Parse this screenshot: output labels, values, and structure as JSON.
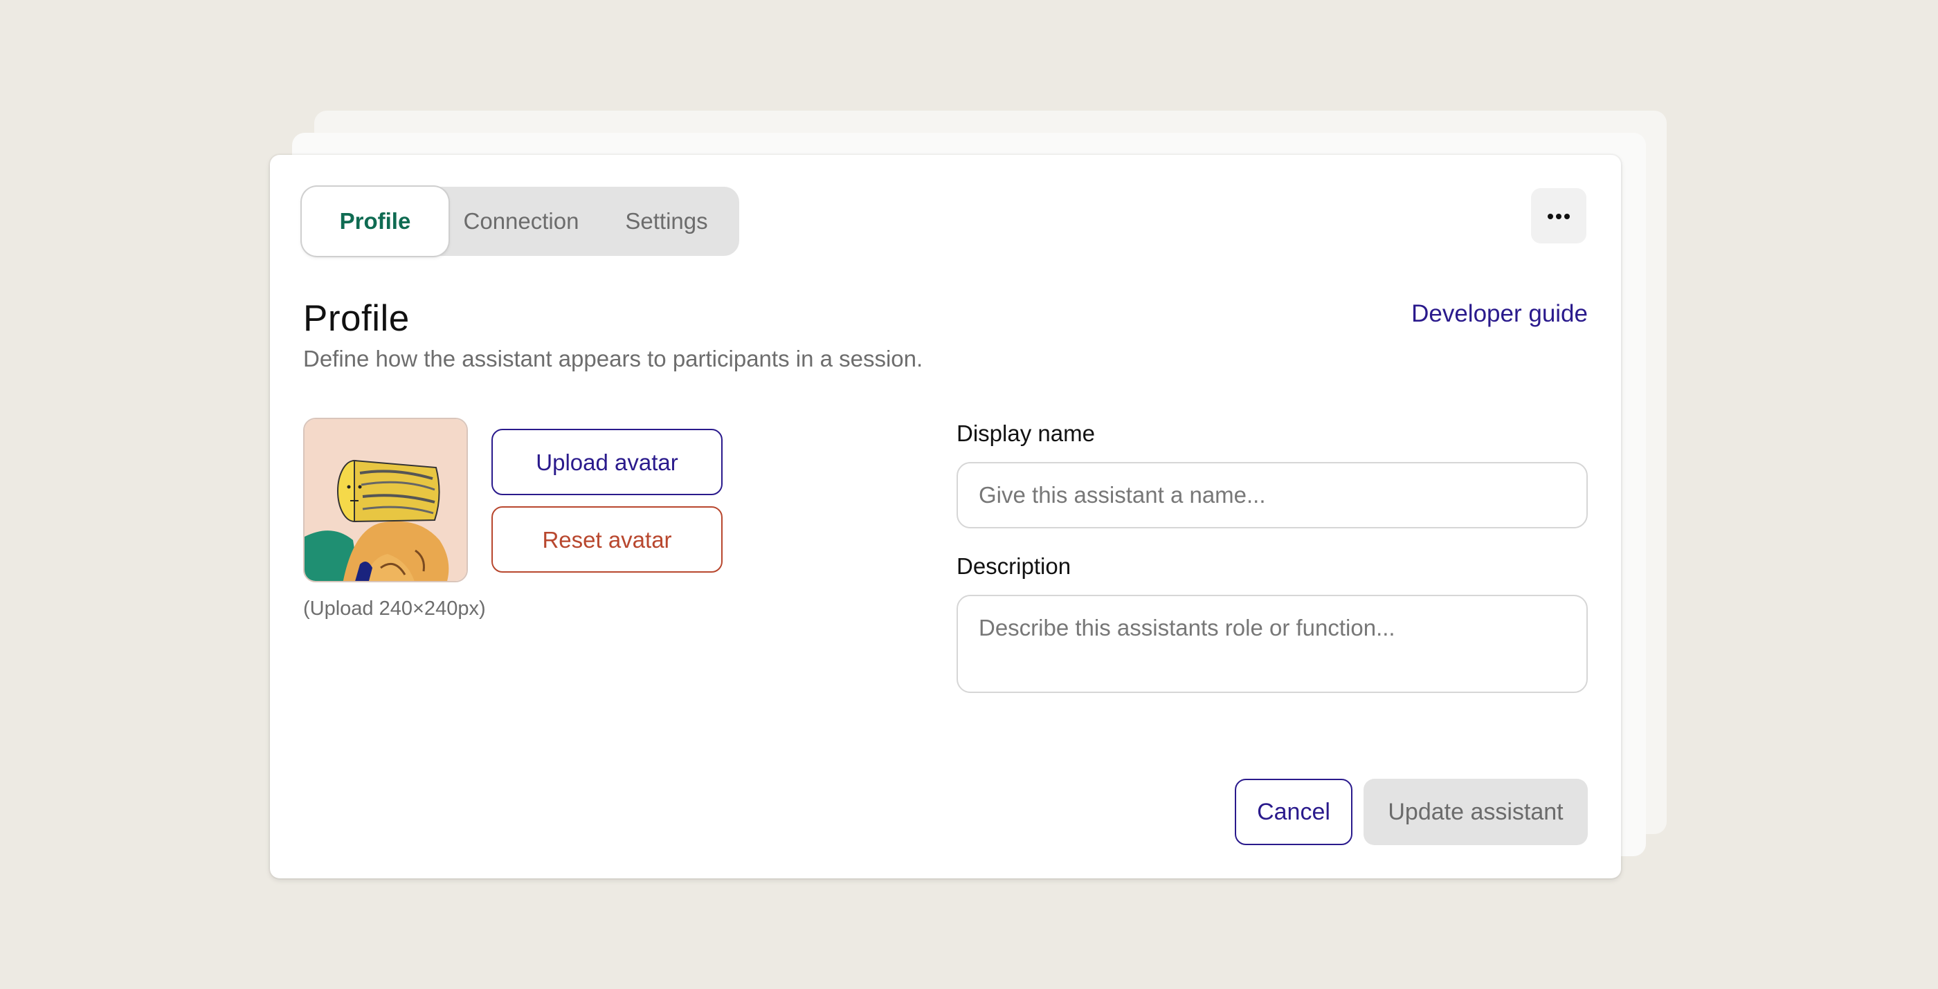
{
  "tabs": [
    {
      "label": "Profile",
      "active": true
    },
    {
      "label": "Connection",
      "active": false
    },
    {
      "label": "Settings",
      "active": false
    }
  ],
  "header": {
    "more_icon": "more-horizontal-icon",
    "title": "Profile",
    "subtitle": "Define how the assistant appears to participants in a session.",
    "developer_guide_link": "Developer guide"
  },
  "avatar": {
    "hint": "(Upload 240×240px)",
    "upload_label": "Upload avatar",
    "reset_label": "Reset avatar"
  },
  "form": {
    "display_name_label": "Display name",
    "display_name_placeholder": "Give this assistant a name...",
    "display_name_value": "",
    "description_label": "Description",
    "description_placeholder": "Describe this assistants role or function...",
    "description_value": ""
  },
  "actions": {
    "cancel_label": "Cancel",
    "update_label": "Update assistant"
  },
  "colors": {
    "accent": "#2a1a8c",
    "active_tab": "#0f6b52",
    "danger": "#b8472e",
    "page_bg": "#edeae3"
  }
}
